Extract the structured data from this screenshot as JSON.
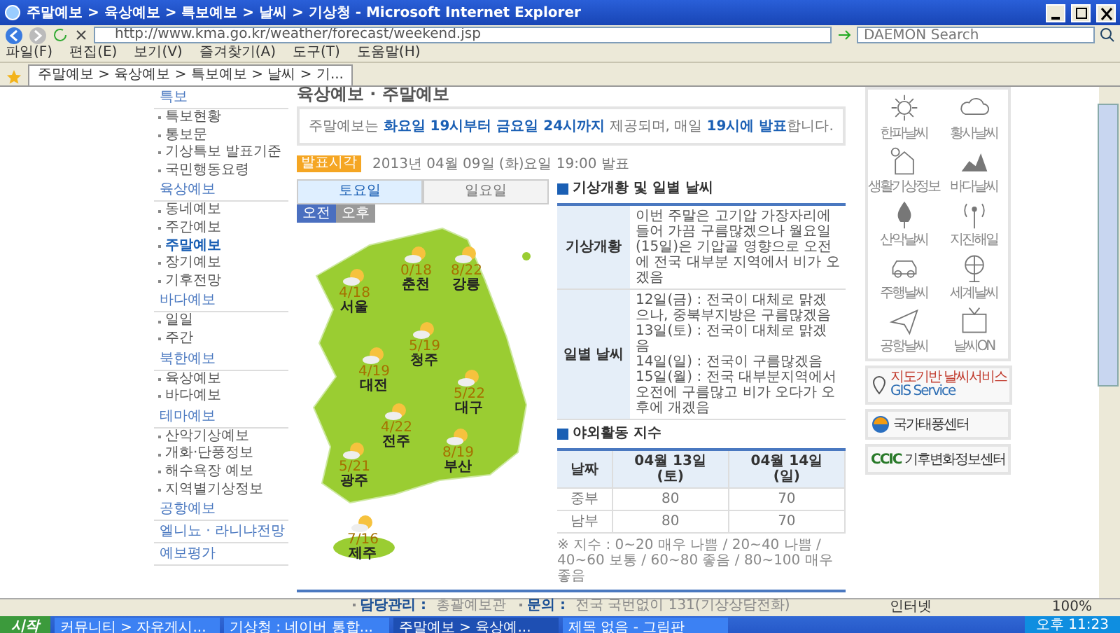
{
  "window": {
    "title": "주말예보 > 육상예보 > 특보예보 > 날씨 > 기상청 - Microsoft Internet Explorer"
  },
  "address_bar": {
    "url": "http://www.kma.go.kr/weather/forecast/weekend.jsp",
    "search_placeholder": "DAEMON Search"
  },
  "menu": [
    "파일(F)",
    "편집(E)",
    "보기(V)",
    "즐겨찾기(A)",
    "도구(T)",
    "도움말(H)"
  ],
  "browser_tabs": [
    {
      "label": "주말예보 > 육상예보 > 특보예보 > 날씨 > 기...",
      "selected": true
    }
  ],
  "sidebar": [
    {
      "title": "특보",
      "items": [
        {
          "label": "특보현황",
          "selected": false
        },
        {
          "label": "통보문",
          "selected": false
        },
        {
          "label": "기상특보 발표기준",
          "selected": false
        },
        {
          "label": "국민행동요령",
          "selected": false
        }
      ]
    },
    {
      "title": "육상예보",
      "items": [
        {
          "label": "동네예보",
          "selected": false
        },
        {
          "label": "주간예보",
          "selected": false
        },
        {
          "label": "주말예보",
          "selected": true
        },
        {
          "label": "장기예보",
          "selected": false
        },
        {
          "label": "기후전망",
          "selected": false
        }
      ]
    },
    {
      "title": "바다예보",
      "items": [
        {
          "label": "일일",
          "selected": false
        },
        {
          "label": "주간",
          "selected": false
        }
      ]
    },
    {
      "title": "북한예보",
      "items": [
        {
          "label": "육상예보",
          "selected": false
        },
        {
          "label": "바다예보",
          "selected": false
        }
      ]
    },
    {
      "title": "테마예보",
      "items": [
        {
          "label": "산악기상예보",
          "selected": false
        },
        {
          "label": "개화·단풍정보",
          "selected": false
        },
        {
          "label": "해수욕장 예보",
          "selected": false
        },
        {
          "label": "지역별기상정보",
          "selected": false
        }
      ]
    },
    {
      "title": "공항예보"
    },
    {
      "title": "엘니뇨 · 라니냐전망"
    },
    {
      "title": "예보평가"
    }
  ],
  "page": {
    "heading": "육상예보 · 주말예보",
    "notice": "주말예보는 **화요일 19시부터 금요일 24시까지** 제공되며, 매일 **19시에 발표**합니다.",
    "issued_badge": "발표시각",
    "issued_text": "2013년 04월 09일 (화)요일 19:00 발표",
    "day_tabs": [
      {
        "label": "토요일",
        "selected": true
      },
      {
        "label": "일요일",
        "selected": false
      }
    ],
    "period_tabs": [
      {
        "label": "오전",
        "selected": true
      },
      {
        "label": "오후",
        "selected": false
      }
    ],
    "map_cities": [
      {
        "name": "서울",
        "temps": "4/18"
      },
      {
        "name": "춘천",
        "temps": "0/18"
      },
      {
        "name": "강릉",
        "temps": "8/22"
      },
      {
        "name": "청주",
        "temps": "5/19"
      },
      {
        "name": "대전",
        "temps": "4/19"
      },
      {
        "name": "대구",
        "temps": "5/22"
      },
      {
        "name": "전주",
        "temps": "4/22"
      },
      {
        "name": "광주",
        "temps": "5/21"
      },
      {
        "name": "부산",
        "temps": "8/19"
      },
      {
        "name": "제주",
        "temps": "7/16"
      }
    ],
    "weather_summary": {
      "title": "기상개황 및 일별 날씨",
      "rows": [
        {
          "label": "기상개황",
          "lines": [
            "이번 주말은 고기압 가장자리에 들어 가끔 구름많겠으나 월요일(15일)은 기압골 영향으로 오전에 전국 대부분 지역에서 비가 오겠음"
          ]
        },
        {
          "label": "일별 날씨",
          "lines": [
            "12일(금) : 전국이 대체로 맑겠으나, 중북부지방은 구름많겠음",
            "13일(토) : 전국이 대체로 맑겠음",
            "14일(일) : 전국이 구름많겠음",
            "15일(월) : 전국 대부분지역에서 오전에 구름많고 비가 오다가 오후에 개겠음"
          ]
        }
      ]
    },
    "outdoor_index": {
      "title": "야외활동 지수",
      "corner": "날짜",
      "columns": [
        {
          "date": "04월 13일",
          "day": "(토)"
        },
        {
          "date": "04월 14일",
          "day": "(일)"
        }
      ],
      "rows": [
        {
          "region": "중부",
          "values": [
            "80",
            "70"
          ]
        },
        {
          "region": "남부",
          "values": [
            "80",
            "70"
          ]
        }
      ],
      "note": "※ 지수 : 0~20 매우 나쁨 / 20~40 나쁨 / 40~60 보통 / 60~80 좋음 / 80~100 매우 좋음"
    },
    "footer": [
      {
        "label": "담당관리 :",
        "value": "총괄예보관"
      },
      {
        "label": "문의 :",
        "value": "전국 국번없이 131(기상상담전화)"
      }
    ]
  },
  "quick_links": [
    "한파날씨",
    "황사날씨",
    "생활기상정보",
    "바다날씨",
    "산악날씨",
    "지진해일",
    "주행날씨",
    "세계날씨",
    "공항날씨",
    "날씨ON"
  ],
  "banners": [
    {
      "kind": "gis",
      "text": "지도기반 날씨서비스",
      "subtext": "GIS Service"
    },
    {
      "kind": "typhoon",
      "text": "국가태풍센터"
    },
    {
      "kind": "climate",
      "logo": "CCIC",
      "text": "기후변화정보센터"
    }
  ],
  "status_bar": {
    "zone": "인터넷",
    "zoom": "100%"
  },
  "taskbar": {
    "start": "시작",
    "tasks": [
      {
        "label": "커뮤니티 > 자유게시...",
        "selected": false
      },
      {
        "label": "기상청 : 네이버 통합...",
        "selected": false
      },
      {
        "label": "주말예보 > 육상예...",
        "selected": true
      },
      {
        "label": "제목 없음 - 그림판",
        "selected": false
      }
    ],
    "clock": "오후 11:23"
  }
}
